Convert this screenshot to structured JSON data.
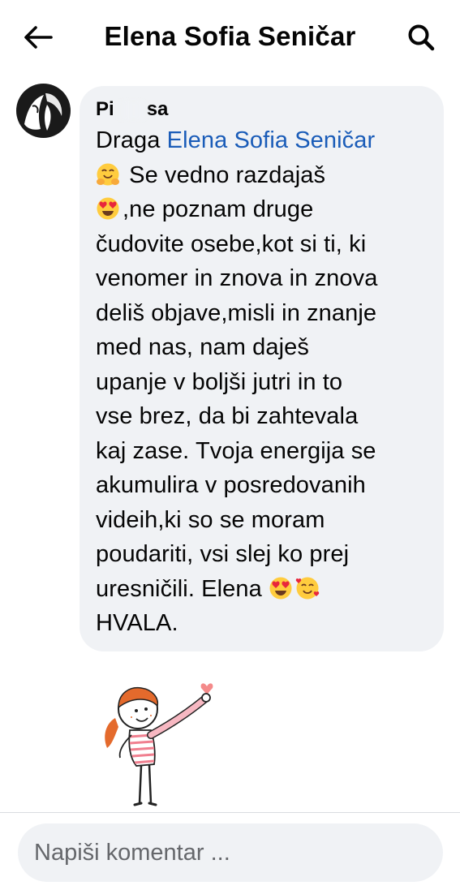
{
  "header": {
    "title": "Elena Sofia Seničar",
    "back_icon": "arrow-left-icon",
    "search_icon": "search-icon"
  },
  "comment": {
    "author": "Pi... ...kasa",
    "author_visible_start": "Pi",
    "author_visible_end": "sa",
    "lines": [
      {
        "prefix": "Draga ",
        "mention": "Elena Sofia Seničar"
      },
      {
        "emoji": "hugging-face-emoji",
        "text": " Se vedno razdajaš"
      },
      {
        "emoji": "heart-eyes-emoji",
        "text": ",ne poznam druge"
      },
      {
        "text": "čudovite osebe,kot si ti, ki"
      },
      {
        "text": "venomer in znova in znova"
      },
      {
        "text": "deliš objave,misli in znanje"
      },
      {
        "text": "med nas, nam daješ"
      },
      {
        "text": "upanje v boljši jutri in to"
      },
      {
        "text": "vse brez, da bi zahtevala"
      },
      {
        "text": "kaj zase. Tvoja energija se"
      },
      {
        "text": "akumulira v posredovanih"
      },
      {
        "text": "videih,ki so se moram"
      },
      {
        "text": "poudariti, vsi slej ko prej"
      },
      {
        "text": "uresničili. Elena ",
        "trailing_emojis": [
          "heart-eyes-emoji",
          "smiling-face-with-hearts-emoji"
        ]
      },
      {
        "text": "HVALA."
      }
    ]
  },
  "sticker": {
    "icon": "waving-girl-sticker-icon"
  },
  "composer": {
    "placeholder": "Napiši komentar ..."
  },
  "colors": {
    "bubble": "#f0f2f5",
    "mention": "#1a5cb8",
    "text": "#050505",
    "placeholder": "#65676b"
  }
}
